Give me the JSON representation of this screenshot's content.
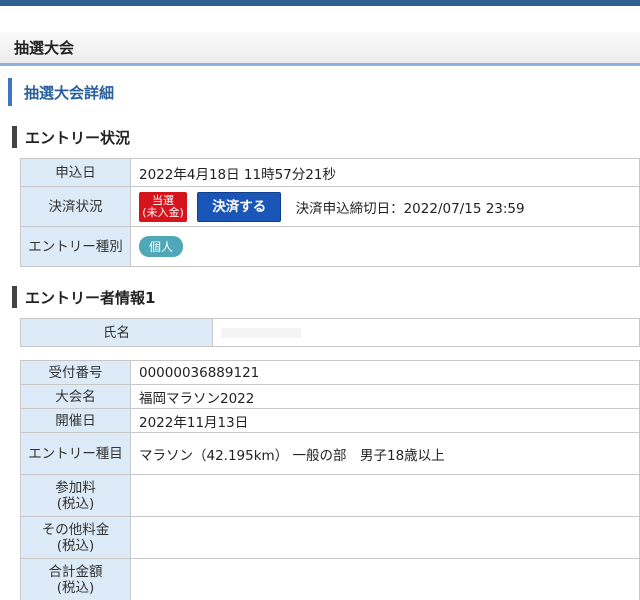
{
  "header": {
    "title": "抽選大会"
  },
  "detail_title": "抽選大会詳細",
  "entry_status": {
    "heading": "エントリー状況",
    "rows": {
      "date_label": "申込日",
      "date_value": "2022年4月18日 11時57分21秒",
      "payment_label": "決済状況",
      "badge_line1": "当選",
      "badge_line2": "(未入金)",
      "pay_button": "決済する",
      "deadline": "決済申込締切日：2022/07/15 23:59",
      "type_label": "エントリー種別",
      "type_value": "個人"
    }
  },
  "entrant": {
    "heading": "エントリー者情報1",
    "name_label": "氏名",
    "rows": [
      {
        "label": "受付番号",
        "value": "00000036889121"
      },
      {
        "label": "大会名",
        "value": "福岡マラソン2022"
      },
      {
        "label": "開催日",
        "value": "2022年11月13日"
      },
      {
        "label": "エントリー種目",
        "value": "マラソン（42.195km） 一般の部　男子18歳以上"
      },
      {
        "label": "参加料\n(税込)",
        "value": ""
      },
      {
        "label": "その他料金\n(税込)",
        "value": ""
      },
      {
        "label": "合計金額\n(税込)",
        "value": ""
      }
    ]
  },
  "colors": {
    "accent": "#2f5f93",
    "label_bg": "#ddeaf8",
    "badge_red": "#d6141e",
    "button_blue": "#1a56b8"
  }
}
